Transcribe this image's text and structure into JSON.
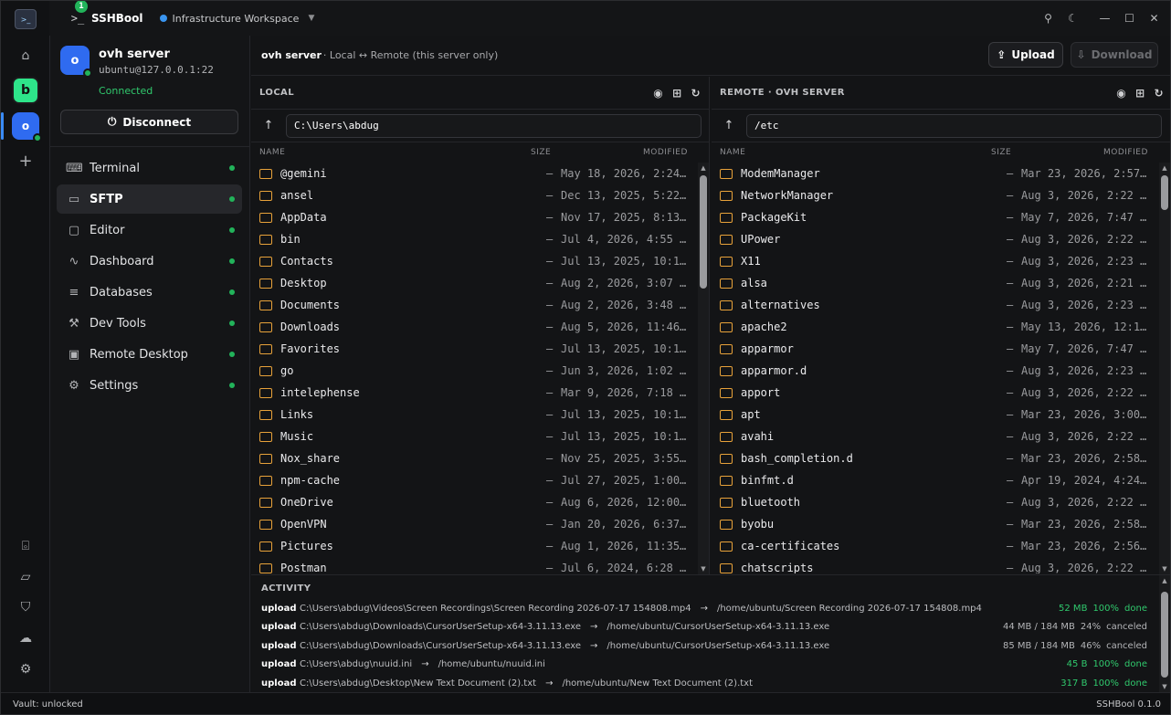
{
  "titlebar": {
    "app_name": "SSHBool",
    "badge_count": "1",
    "workspace": "Infrastructure Workspace",
    "workspace_dot_color": "#3a95f0"
  },
  "rail": {
    "logo_text": "SSH BOOL",
    "app_initial": "b",
    "server_initial": "o",
    "accent": "#2ee58a"
  },
  "server": {
    "initial": "o",
    "name": "ovh server",
    "address": "ubuntu@127.0.0.1:22",
    "status": "Connected",
    "disconnect_label": "Disconnect"
  },
  "nav": [
    {
      "label": "Terminal",
      "icon": "terminal-icon",
      "glyph": "⌨"
    },
    {
      "label": "SFTP",
      "icon": "drive-icon",
      "glyph": "▭",
      "active": true
    },
    {
      "label": "Editor",
      "icon": "editor-icon",
      "glyph": "▢"
    },
    {
      "label": "Dashboard",
      "icon": "activity-icon",
      "glyph": "∿"
    },
    {
      "label": "Databases",
      "icon": "database-icon",
      "glyph": "≡"
    },
    {
      "label": "Dev Tools",
      "icon": "wrench-icon",
      "glyph": "⚒"
    },
    {
      "label": "Remote Desktop",
      "icon": "monitor-icon",
      "glyph": "▣"
    },
    {
      "label": "Settings",
      "icon": "gear-icon",
      "glyph": "⚙"
    }
  ],
  "header": {
    "title": "ovh server",
    "subtitle": "· Local ↔ Remote (this server only)",
    "upload_label": "Upload",
    "download_label": "Download"
  },
  "local": {
    "title": "LOCAL",
    "path": "C:\\Users\\abdug",
    "columns": {
      "name": "NAME",
      "size": "SIZE",
      "modified": "MODIFIED"
    },
    "rows": [
      {
        "name": "@gemini",
        "size": "—",
        "modified": "May 18, 2026, 2:24…"
      },
      {
        "name": "ansel",
        "size": "—",
        "modified": "Dec 13, 2025, 5:22…"
      },
      {
        "name": "AppData",
        "size": "—",
        "modified": "Nov 17, 2025, 8:13…"
      },
      {
        "name": "bin",
        "size": "—",
        "modified": "Jul 4, 2026, 4:55 …"
      },
      {
        "name": "Contacts",
        "size": "—",
        "modified": "Jul 13, 2025, 10:1…"
      },
      {
        "name": "Desktop",
        "size": "—",
        "modified": "Aug 2, 2026, 3:07 …"
      },
      {
        "name": "Documents",
        "size": "—",
        "modified": "Aug 2, 2026, 3:48 …"
      },
      {
        "name": "Downloads",
        "size": "—",
        "modified": "Aug 5, 2026, 11:46…"
      },
      {
        "name": "Favorites",
        "size": "—",
        "modified": "Jul 13, 2025, 10:1…"
      },
      {
        "name": "go",
        "size": "—",
        "modified": "Jun 3, 2026, 1:02 …"
      },
      {
        "name": "intelephense",
        "size": "—",
        "modified": "Mar 9, 2026, 7:18 …"
      },
      {
        "name": "Links",
        "size": "—",
        "modified": "Jul 13, 2025, 10:1…"
      },
      {
        "name": "Music",
        "size": "—",
        "modified": "Jul 13, 2025, 10:1…"
      },
      {
        "name": "Nox_share",
        "size": "—",
        "modified": "Nov 25, 2025, 3:55…"
      },
      {
        "name": "npm-cache",
        "size": "—",
        "modified": "Jul 27, 2025, 1:00…"
      },
      {
        "name": "OneDrive",
        "size": "—",
        "modified": "Aug 6, 2026, 12:00…"
      },
      {
        "name": "OpenVPN",
        "size": "—",
        "modified": "Jan 20, 2026, 6:37…"
      },
      {
        "name": "Pictures",
        "size": "—",
        "modified": "Aug 1, 2026, 11:35…"
      },
      {
        "name": "Postman",
        "size": "—",
        "modified": "Jul 6, 2024, 6:28 …"
      }
    ]
  },
  "remote": {
    "title": "REMOTE · OVH SERVER",
    "path": "/etc",
    "columns": {
      "name": "NAME",
      "size": "SIZE",
      "modified": "MODIFIED"
    },
    "rows": [
      {
        "name": "ModemManager",
        "size": "—",
        "modified": "Mar 23, 2026, 2:57…"
      },
      {
        "name": "NetworkManager",
        "size": "—",
        "modified": "Aug 3, 2026, 2:22 …"
      },
      {
        "name": "PackageKit",
        "size": "—",
        "modified": "May 7, 2026, 7:47 …"
      },
      {
        "name": "UPower",
        "size": "—",
        "modified": "Aug 3, 2026, 2:22 …"
      },
      {
        "name": "X11",
        "size": "—",
        "modified": "Aug 3, 2026, 2:23 …"
      },
      {
        "name": "alsa",
        "size": "—",
        "modified": "Aug 3, 2026, 2:21 …"
      },
      {
        "name": "alternatives",
        "size": "—",
        "modified": "Aug 3, 2026, 2:23 …"
      },
      {
        "name": "apache2",
        "size": "—",
        "modified": "May 13, 2026, 12:1…"
      },
      {
        "name": "apparmor",
        "size": "—",
        "modified": "May 7, 2026, 7:47 …"
      },
      {
        "name": "apparmor.d",
        "size": "—",
        "modified": "Aug 3, 2026, 2:23 …"
      },
      {
        "name": "apport",
        "size": "—",
        "modified": "Aug 3, 2026, 2:22 …"
      },
      {
        "name": "apt",
        "size": "—",
        "modified": "Mar 23, 2026, 3:00…"
      },
      {
        "name": "avahi",
        "size": "—",
        "modified": "Aug 3, 2026, 2:22 …"
      },
      {
        "name": "bash_completion.d",
        "size": "—",
        "modified": "Mar 23, 2026, 2:58…"
      },
      {
        "name": "binfmt.d",
        "size": "—",
        "modified": "Apr 19, 2024, 4:24…"
      },
      {
        "name": "bluetooth",
        "size": "—",
        "modified": "Aug 3, 2026, 2:22 …"
      },
      {
        "name": "byobu",
        "size": "—",
        "modified": "Mar 23, 2026, 2:58…"
      },
      {
        "name": "ca-certificates",
        "size": "—",
        "modified": "Mar 23, 2026, 2:56…"
      },
      {
        "name": "chatscripts",
        "size": "—",
        "modified": "Aug 3, 2026, 2:22 …"
      }
    ]
  },
  "activity": {
    "title": "ACTIVITY",
    "items": [
      {
        "kind": "upload",
        "from": "C:\\Users\\abdug\\Videos\\Screen Recordings\\Screen Recording 2026-07-17 154808.mp4",
        "to": "/home/ubuntu/Screen Recording 2026-07-17 154808.mp4",
        "size": "52 MB",
        "pct": "100%",
        "state": "done"
      },
      {
        "kind": "upload",
        "from": "C:\\Users\\abdug\\Downloads\\CursorUserSetup-x64-3.11.13.exe",
        "to": "/home/ubuntu/CursorUserSetup-x64-3.11.13.exe",
        "size": "44 MB / 184 MB",
        "pct": "24%",
        "state": "canceled"
      },
      {
        "kind": "upload",
        "from": "C:\\Users\\abdug\\Downloads\\CursorUserSetup-x64-3.11.13.exe",
        "to": "/home/ubuntu/CursorUserSetup-x64-3.11.13.exe",
        "size": "85 MB / 184 MB",
        "pct": "46%",
        "state": "canceled"
      },
      {
        "kind": "upload",
        "from": "C:\\Users\\abdug\\nuuid.ini",
        "to": "/home/ubuntu/nuuid.ini",
        "size": "45 B",
        "pct": "100%",
        "state": "done"
      },
      {
        "kind": "upload",
        "from": "C:\\Users\\abdug\\Desktop\\New Text Document (2).txt",
        "to": "/home/ubuntu/New Text Document (2).txt",
        "size": "317 B",
        "pct": "100%",
        "state": "done"
      }
    ]
  },
  "footer": {
    "vault": "Vault: unlocked",
    "version": "SSHBool 0.1.0"
  },
  "colors": {
    "success": "#30c96d",
    "folder": "#e8a23a",
    "brand_blue": "#2f6bf0"
  }
}
